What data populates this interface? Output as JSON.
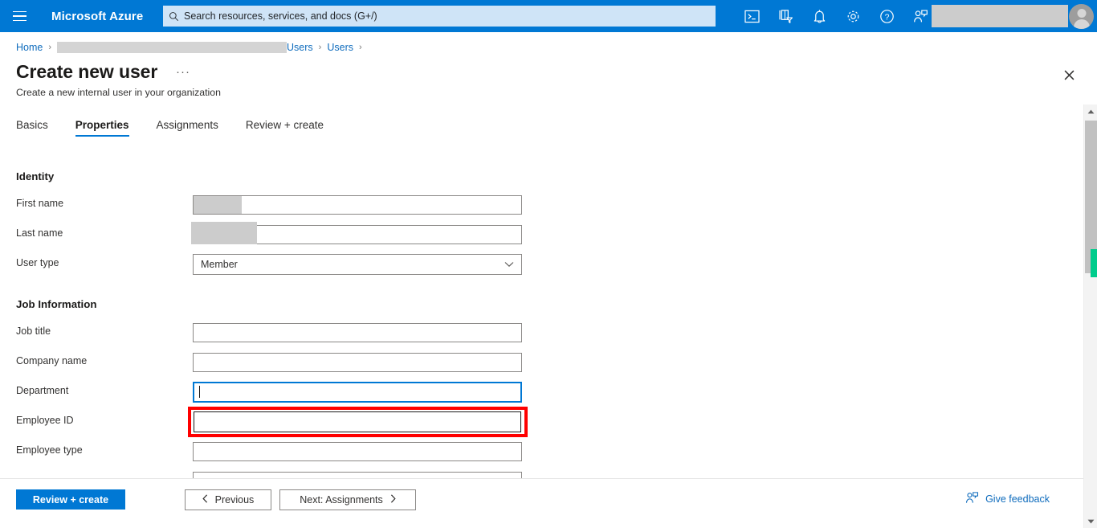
{
  "topbar": {
    "menu_icon": "hamburger-menu-icon",
    "brand": "Microsoft Azure",
    "search": {
      "icon": "search-icon",
      "placeholder": "Search resources, services, and docs (G+/)",
      "value": ""
    },
    "icons": [
      {
        "name": "cloud-shell-icon",
        "label": "Cloud Shell"
      },
      {
        "name": "directory-filter-icon",
        "label": "Directories + subscriptions"
      },
      {
        "name": "notifications-bell-icon",
        "label": "Notifications"
      },
      {
        "name": "settings-gear-icon",
        "label": "Settings"
      },
      {
        "name": "help-question-icon",
        "label": "Help"
      },
      {
        "name": "feedback-person-icon",
        "label": "Feedback"
      }
    ],
    "account_name_redacted": true,
    "avatar": "user-avatar"
  },
  "breadcrumb": {
    "items": [
      {
        "label": "Home",
        "redacted": false
      },
      {
        "label": "",
        "redacted": true
      },
      {
        "label": "Users",
        "redacted": false
      },
      {
        "label": "Users",
        "redacted": false
      }
    ],
    "separator": "›"
  },
  "header": {
    "title": "Create new user",
    "ellipsis": "···",
    "subtitle": "Create a new internal user in your organization",
    "close_label": "Close"
  },
  "tabs": [
    {
      "label": "Basics",
      "active": false
    },
    {
      "label": "Properties",
      "active": true
    },
    {
      "label": "Assignments",
      "active": false
    },
    {
      "label": "Review + create",
      "active": false
    }
  ],
  "form": {
    "sections": [
      {
        "heading": "Identity",
        "fields": [
          {
            "label": "First name",
            "type": "text",
            "value": "",
            "redacted": true,
            "state": "normal"
          },
          {
            "label": "Last name",
            "type": "text",
            "value": "",
            "redacted": true,
            "state": "normal"
          },
          {
            "label": "User type",
            "type": "select",
            "value": "Member",
            "state": "normal"
          }
        ]
      },
      {
        "heading": "Job Information",
        "fields": [
          {
            "label": "Job title",
            "type": "text",
            "value": "",
            "state": "normal"
          },
          {
            "label": "Company name",
            "type": "text",
            "value": "",
            "state": "normal"
          },
          {
            "label": "Department",
            "type": "text",
            "value": "",
            "state": "focused"
          },
          {
            "label": "Employee ID",
            "type": "text",
            "value": "",
            "state": "highlighted"
          },
          {
            "label": "Employee type",
            "type": "text",
            "value": "",
            "state": "normal"
          }
        ]
      }
    ]
  },
  "annotation": {
    "highlight_color": "#ff0000",
    "highlight_target": "Employee ID"
  },
  "scrollbar": {
    "up_arrow": "scroll-up-arrow-icon",
    "down_arrow": "scroll-down-arrow-icon",
    "marker_color": "#00cc8c"
  },
  "footer": {
    "primary_label": "Review + create",
    "previous_label": "Previous",
    "next_label": "Next: Assignments",
    "feedback_label": "Give feedback",
    "feedback_icon": "feedback-person-icon"
  },
  "colors": {
    "azure_blue": "#0078d4",
    "link_blue": "#0f6cbd",
    "red_highlight": "#ff0000",
    "green_marker": "#00cc8c"
  }
}
